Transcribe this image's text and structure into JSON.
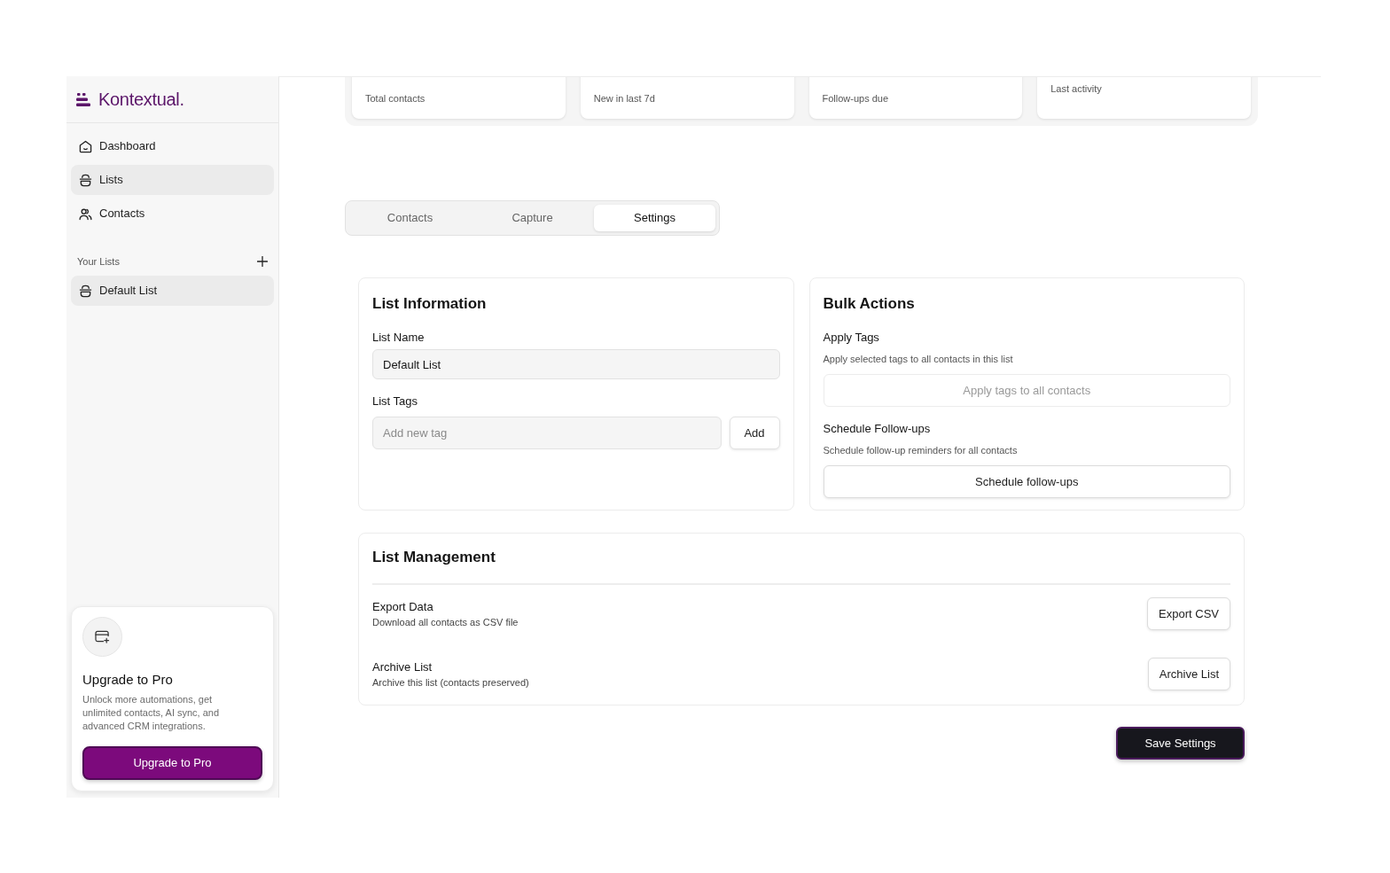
{
  "brand": {
    "name": "Kontextual."
  },
  "sidebar": {
    "items": [
      {
        "label": "Dashboard",
        "selected": false
      },
      {
        "label": "Lists",
        "selected": true
      },
      {
        "label": "Contacts",
        "selected": false
      }
    ],
    "section": {
      "title": "Your Lists",
      "items": [
        {
          "label": "Default List",
          "selected": true
        }
      ]
    }
  },
  "upgrade_card": {
    "title": "Upgrade to Pro",
    "description": "Unlock more automations, get unlimited contacts, AI sync, and advanced CRM integrations.",
    "button": "Upgrade to Pro"
  },
  "stats": [
    {
      "kind": "count",
      "label": "Total contacts"
    },
    {
      "kind": "count",
      "label": "New in last 7d"
    },
    {
      "kind": "count",
      "label": "Follow-ups due"
    },
    {
      "kind": "text",
      "label": "Last activity"
    }
  ],
  "tabs": [
    {
      "label": "Contacts",
      "selected": false
    },
    {
      "label": "Capture",
      "selected": false
    },
    {
      "label": "Settings",
      "selected": true
    }
  ],
  "list_information": {
    "title": "List Information",
    "list_name": {
      "label": "List Name",
      "value": "Default List"
    },
    "list_tags": {
      "label": "List Tags",
      "placeholder": "Add new tag",
      "button": "Add"
    }
  },
  "bulk_actions": {
    "title": "Bulk Actions",
    "actions": [
      {
        "title": "Apply Tags",
        "description": "Apply selected tags to all contacts in this list",
        "button": "Apply tags to all contacts",
        "disabled": true
      },
      {
        "title": "Schedule Follow-ups",
        "description": "Schedule follow-up reminders for all contacts",
        "button": "Schedule follow-ups",
        "disabled": false
      }
    ]
  },
  "list_management": {
    "title": "List Management",
    "rows": [
      {
        "title": "Export Data",
        "description": "Download all contacts as CSV file",
        "button": "Export CSV"
      },
      {
        "title": "Archive List",
        "description": "Archive this list (contacts preserved)",
        "button": "Archive List"
      }
    ]
  },
  "save_button": {
    "label": "Save Settings"
  }
}
